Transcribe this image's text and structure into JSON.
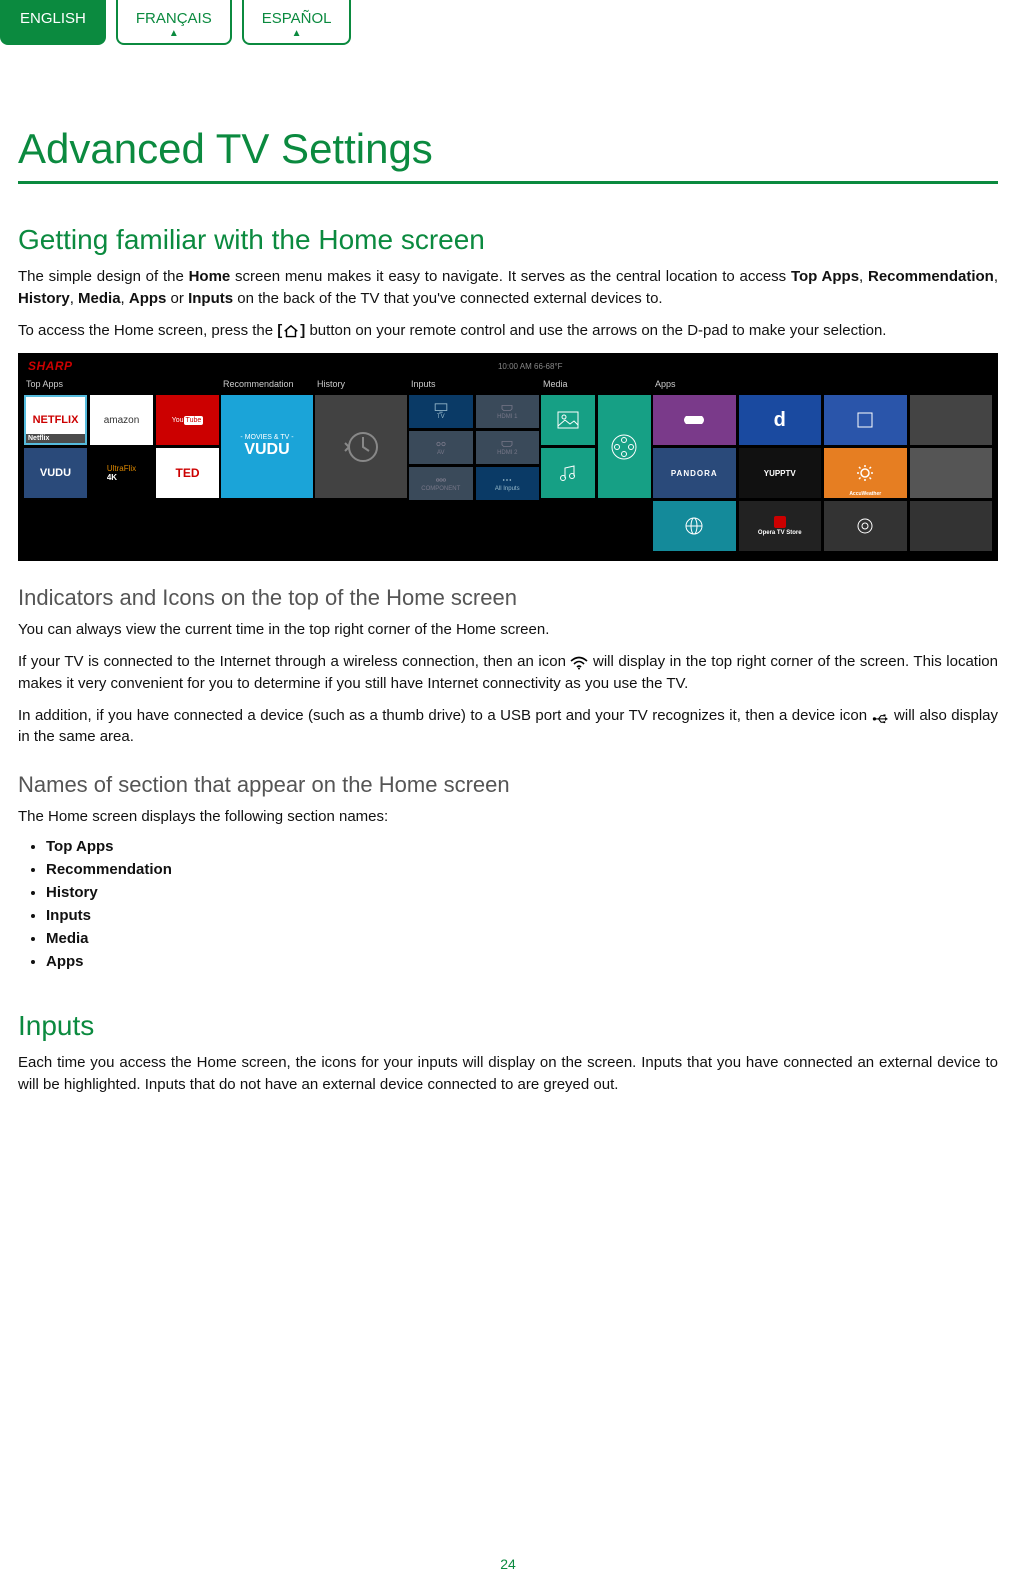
{
  "lang_tabs": {
    "english": "ENGLISH",
    "francais": "FRANÇAIS",
    "espanol": "ESPAÑOL"
  },
  "title": "Advanced TV Settings",
  "s1": {
    "heading": "Getting familiar with the Home screen",
    "p1a": "The simple design of the ",
    "p1b": "Home",
    "p1c": " screen menu makes it easy to navigate. It serves as the central location to access ",
    "p1d": "Top Apps",
    "p1e": ", ",
    "p1f": "Recommendation",
    "p1g": ", ",
    "p1h": "History",
    "p1i": ", ",
    "p1j": "Media",
    "p1k": ", ",
    "p1l": "Apps",
    "p1m": " or ",
    "p1n": "Inputs",
    "p1o": " on the back of the TV that you've connected external devices to.",
    "p2a": "To access the Home screen, press the ",
    "p2b": "[",
    "p2c": "]",
    "p2d": " button on your remote control and use the arrows on the D-pad to make your selection."
  },
  "tv": {
    "brand": "SHARP",
    "status": "10:00 AM    66-68°F",
    "top_apps": "Top Apps",
    "recommendation": "Recommendation",
    "history": "History",
    "inputs": "Inputs",
    "media": "Media",
    "apps": "Apps",
    "netflix": "NETFLIX",
    "netflix_cap": "Netflix",
    "amazon": "amazon",
    "youtube_a": "You",
    "youtube_b": "Tube",
    "vudu": "VUDU",
    "ultraflix_a": "UltraFlix",
    "ultraflix_b": "4K",
    "ted": "TED",
    "recom_sub": "- MOVIES & TV -",
    "recom_main": "VUDU",
    "in_tv": "TV",
    "in_hdmi1": "HDMI 1",
    "in_av": "AV",
    "in_hdmi2": "HDMI 2",
    "in_comp": "COMPONENT",
    "in_all": "All Inputs",
    "pandora": "PANDORA",
    "yupp": "YUPPTV",
    "accu": "AccuWeather",
    "opera": "Opera TV Store",
    "d": "d"
  },
  "s2": {
    "heading": "Indicators and Icons on the top of the Home screen",
    "p1": "You can always view the current time in the top right corner of the Home screen.",
    "p2a": "If your TV is connected to the Internet through a wireless connection, then an icon ",
    "p2b": " will display in the top right corner of the screen. This location makes it very convenient for you to determine if you still have Internet connectivity as you use the TV.",
    "p3a": "In addition, if you have connected a device (such as a thumb drive) to a USB port and your TV recognizes it, then a device icon ",
    "p3b": " will also display in the same area."
  },
  "s3": {
    "heading": "Names of section that appear on the Home screen",
    "intro": "The Home screen displays the following section names:",
    "items": [
      "Top Apps",
      "Recommendation",
      "History",
      "Inputs",
      "Media",
      "Apps"
    ]
  },
  "s4": {
    "heading": "Inputs",
    "p1": "Each time you access the Home screen, the icons for your inputs will display on the screen. Inputs that you have connected an external device to will be highlighted. Inputs that do not have an external device connected to are greyed out."
  },
  "page_number": "24"
}
